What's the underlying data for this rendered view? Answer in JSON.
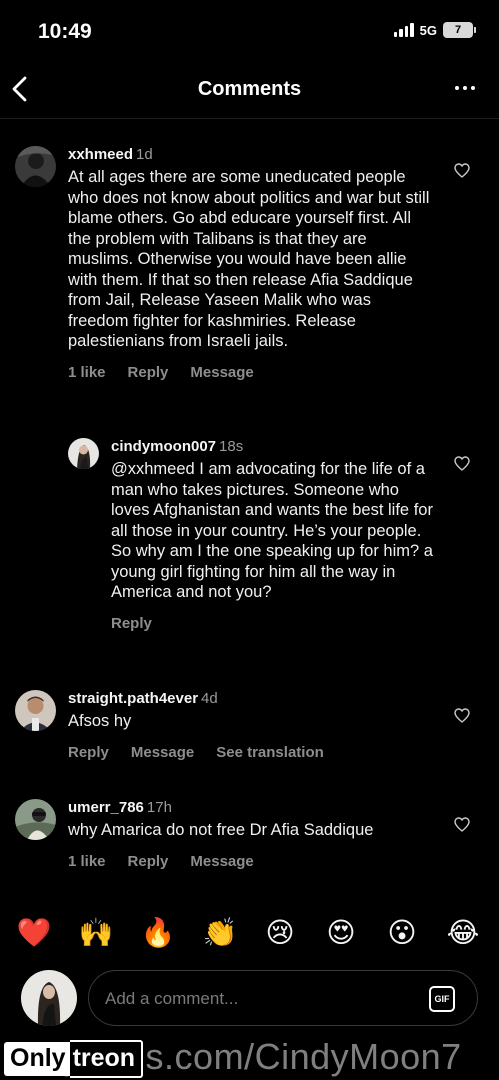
{
  "status_bar": {
    "time": "10:49",
    "network": "5G",
    "battery": "7"
  },
  "header": {
    "title": "Comments"
  },
  "comments": [
    {
      "username": "xxhmeed",
      "time": "1d",
      "text": "At all ages there are some uneducated people who does not know about politics and war but still blame others. Go abd educare yourself first. All the problem with Talibans is that they are muslims. Otherwise you would have been allie with them. If that so then release Afia Saddique from Jail, Release Yaseen Malik who was freedom fighter for kashmiries. Release palestienians from Israeli jails.",
      "likes": "1 like",
      "reply": "Reply",
      "message": "Message"
    },
    {
      "username": "cindymoon007",
      "time": "18s",
      "text": "@xxhmeed I am advocating for the life of a man who takes pictures. Someone who loves Afghanistan and wants the best life for all those in your country. He’s your people. So why am I the one speaking up for him? a young girl fighting for him all the way in America and not you?",
      "reply": "Reply"
    },
    {
      "username": "straight.path4ever",
      "time": "4d",
      "text": "Afsos hy",
      "reply": "Reply",
      "message": "Message",
      "translation": "See translation"
    },
    {
      "username": "umerr_786",
      "time": "17h",
      "text": "why Amarica do not free Dr Afia Saddique",
      "likes": "1 like",
      "reply": "Reply",
      "message": "Message"
    }
  ],
  "reactions": [
    "❤️",
    "🙌",
    "🔥",
    "👏",
    "😢",
    "😍",
    "😮",
    "😂"
  ],
  "composer": {
    "placeholder": "Add a comment...",
    "gif_label": "GIF"
  },
  "watermark": {
    "url": "OnlyFans.com/CindyMoon7",
    "logo_only": "Only",
    "logo_treon": "treon"
  },
  "colors": {
    "background": "#000000",
    "text": "#f5f5f5",
    "muted": "#8e8e8e",
    "border": "#3a3a3a"
  }
}
